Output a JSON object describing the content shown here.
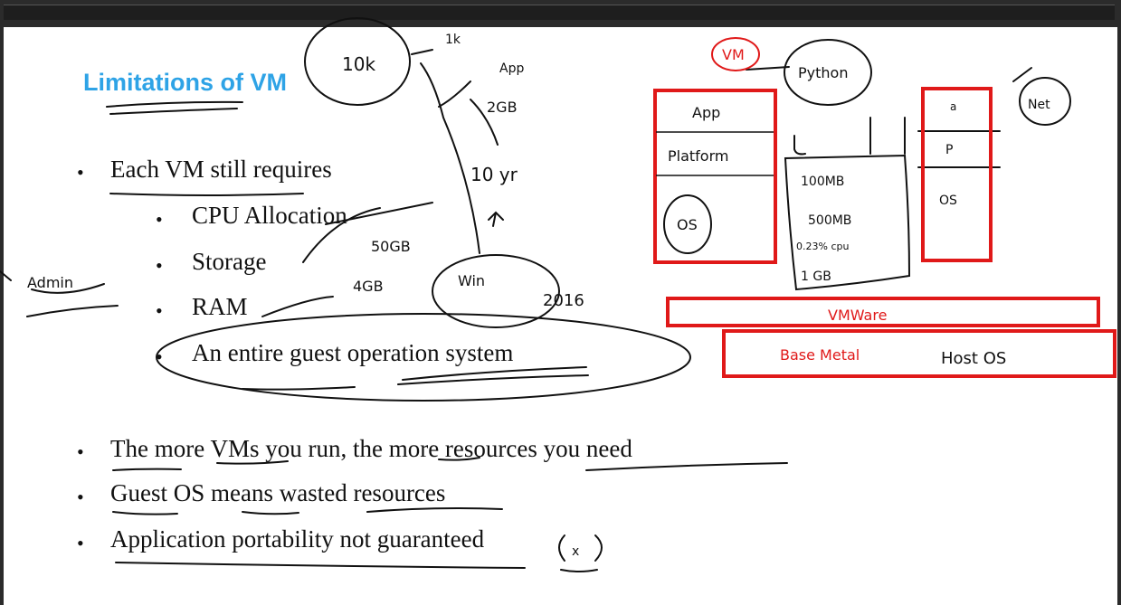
{
  "slide": {
    "title": "Limitations of VM",
    "bullets": [
      {
        "text": "Each  VM still requires",
        "sub": [
          "CPU Allocation",
          "Storage",
          "RAM",
          "An entire guest operation system"
        ]
      },
      {
        "text": "The more VMs you run, the more resources      you need"
      },
      {
        "text": "Guest OS means wasted resources"
      },
      {
        "text": "Application portability not guaranteed"
      }
    ]
  },
  "annotations": {
    "vm_label": "VM",
    "python": "Python",
    "stack_app": "App",
    "stack_platform": "Platform",
    "stack_os": "OS",
    "vmware": "VMWare",
    "base_metal": "Base Metal",
    "host_os": "Host OS",
    "mem_lines": [
      "100MB",
      "500MB",
      "0.23% cpu",
      "1 GB"
    ],
    "right_box": [
      "a",
      "P",
      "OS"
    ],
    "net": "Net",
    "admin": "Admin",
    "top_notes": [
      "10k",
      "1k",
      "App",
      "2GB",
      "10 yr"
    ],
    "storage_note": "50GB",
    "ram_note": "4GB",
    "win_note": "Win",
    "year_note": "2016",
    "x_mark": "x"
  },
  "colors": {
    "title": "#2ea3e6",
    "ink": "#111111",
    "red_ink": "#e01919"
  }
}
